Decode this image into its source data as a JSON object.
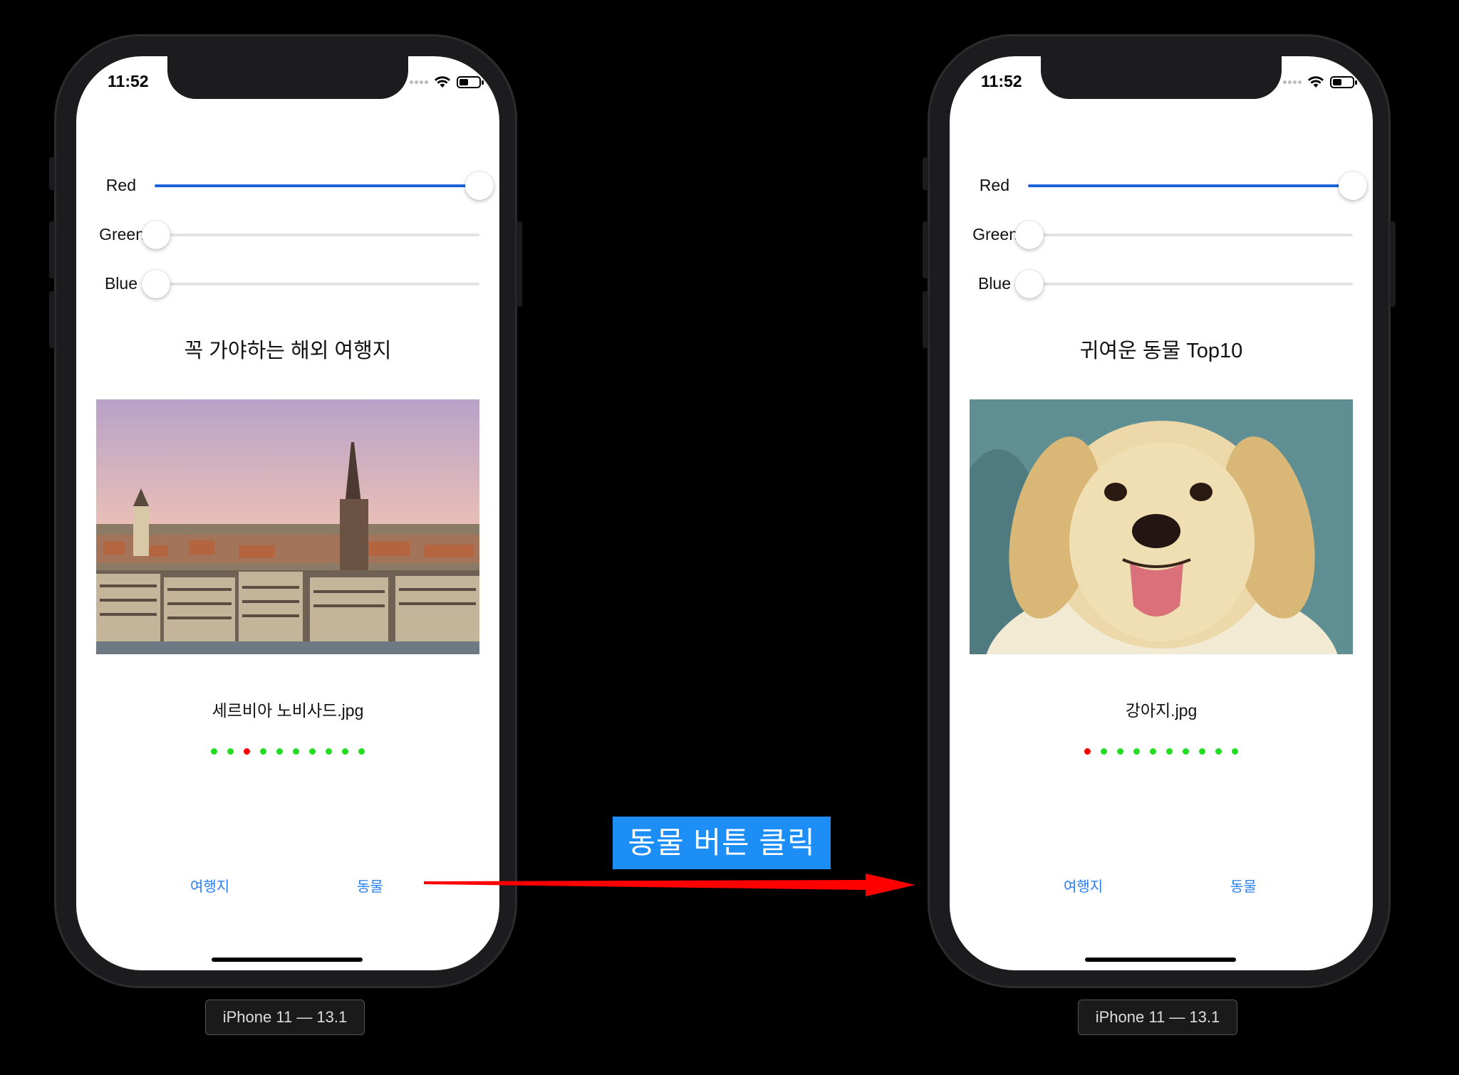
{
  "callout": {
    "text": "동물 버튼 클릭"
  },
  "phones": [
    {
      "status": {
        "time": "11:52"
      },
      "sliders": [
        {
          "label": "Red",
          "value": 1.0
        },
        {
          "label": "Green",
          "value": 0.0
        },
        {
          "label": "Blue",
          "value": 0.0
        }
      ],
      "title": "꼭 가야하는 해외 여행지",
      "image": "serbia-novi-sad-cityscape",
      "filename": "세르비아 노비사드.jpg",
      "pager": {
        "count": 10,
        "current": 2,
        "active_color": "#ff0000",
        "inactive_color": "#22dd22"
      },
      "buttons": {
        "travel": "여행지",
        "animal": "동물"
      },
      "device_label": "iPhone 11 — 13.1"
    },
    {
      "status": {
        "time": "11:52"
      },
      "sliders": [
        {
          "label": "Red",
          "value": 1.0
        },
        {
          "label": "Green",
          "value": 0.0
        },
        {
          "label": "Blue",
          "value": 0.0
        }
      ],
      "title": "귀여운 동물 Top10",
      "image": "puppy",
      "filename": "강아지.jpg",
      "pager": {
        "count": 10,
        "current": 0,
        "active_color": "#ff0000",
        "inactive_color": "#22dd22"
      },
      "buttons": {
        "travel": "여행지",
        "animal": "동물"
      },
      "device_label": "iPhone 11 — 13.1"
    }
  ],
  "colors": {
    "accent": "#2a7ff0",
    "slider_fill": "#1a63d8",
    "callout_bg": "#1e8ef7",
    "arrow": "#ff0000"
  }
}
